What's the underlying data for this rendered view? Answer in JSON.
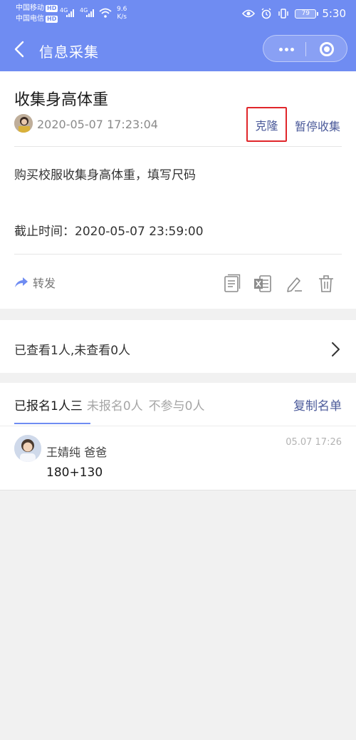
{
  "status_bar": {
    "carrier1": "中国移动",
    "carrier2": "中国电信",
    "hd": "HD",
    "net1": "4G",
    "net2": "4G",
    "speed_value": "9.6",
    "speed_unit": "K/s",
    "battery": "79",
    "time": "5:30"
  },
  "nav": {
    "title": "信息采集"
  },
  "post": {
    "title": "收集身高体重",
    "time": "2020-05-07 17:23:04",
    "clone_label": "克隆",
    "pause_label": "暂停收集",
    "description": "购买校服收集身高体重，填写尺码",
    "deadline": "截止时间：2020-05-07 23:59:00",
    "forward_label": "转发"
  },
  "views": {
    "summary": "已查看1人,未查看0人"
  },
  "signup": {
    "tab_signed": "已报名1人",
    "tab_signed_tail": "三",
    "tab_unsigned": "未报名0人",
    "tab_declined": "不参与0人",
    "copy_label": "复制名单",
    "entries": [
      {
        "name": "王婧纯 爸爸",
        "time": "05.07 17:26",
        "value": "180+130"
      }
    ]
  },
  "colors": {
    "accent": "#6f8cf2",
    "link": "#4b5a9a",
    "highlight_box": "#e0262a"
  }
}
